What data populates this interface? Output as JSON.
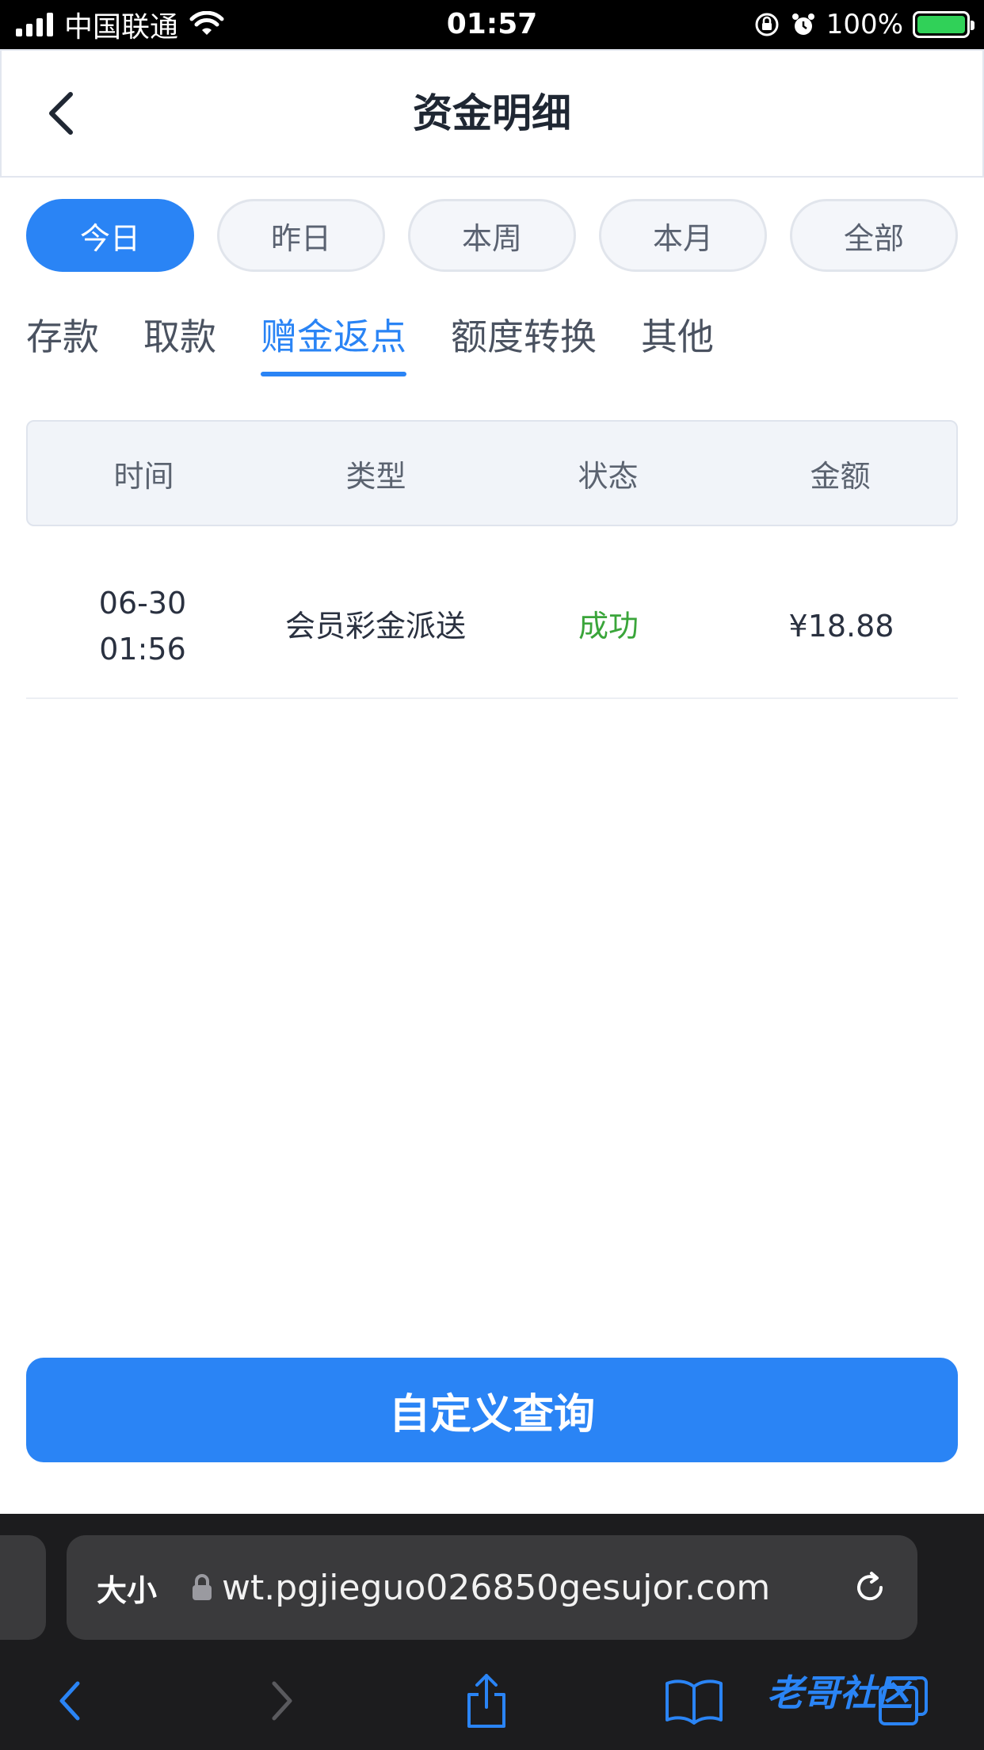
{
  "status_bar": {
    "carrier": "中国联通",
    "time": "01:57",
    "battery": "100%"
  },
  "header": {
    "title": "资金明细"
  },
  "period_filters": [
    {
      "label": "今日",
      "active": true
    },
    {
      "label": "昨日",
      "active": false
    },
    {
      "label": "本周",
      "active": false
    },
    {
      "label": "本月",
      "active": false
    },
    {
      "label": "全部",
      "active": false
    }
  ],
  "category_tabs": [
    {
      "label": "存款",
      "active": false
    },
    {
      "label": "取款",
      "active": false
    },
    {
      "label": "赠金返点",
      "active": true
    },
    {
      "label": "额度转换",
      "active": false
    },
    {
      "label": "其他",
      "active": false
    }
  ],
  "table": {
    "columns": [
      "时间",
      "类型",
      "状态",
      "金额"
    ],
    "rows": [
      {
        "date": "06-30",
        "time": "01:56",
        "type": "会员彩金派送",
        "status": "成功",
        "amount": "¥18.88"
      }
    ]
  },
  "query_button": "自定义查询",
  "browser": {
    "text_size_label": "大小",
    "url": "wt.pgjieguo026850gesujor.com",
    "watermark": "老哥社区"
  },
  "colors": {
    "accent": "#2a84f5",
    "success": "#3aa53a"
  }
}
